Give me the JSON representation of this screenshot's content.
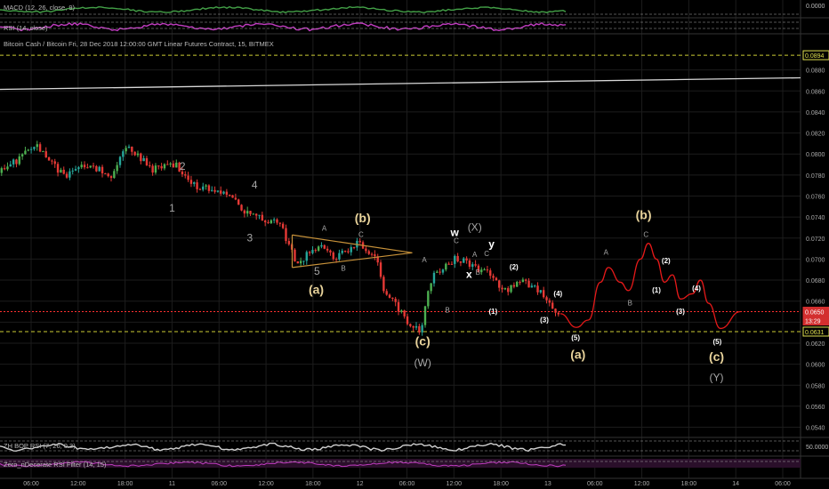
{
  "header": {
    "macd_label": "MACD (12, 26, close, 9)",
    "rsi_label": "RSI (14, close)",
    "symbol_label": "Bitcoin Cash / Bitcoin Fri, 28 Dec 2018 12:00:00 GMT Linear Futures Contract, 15, BITMEX",
    "bop_label": "ZH BOP RSI (7, 26, 0.3)",
    "zero_label": "Zero_nDecerate RSI Filter (14, 15)"
  },
  "macd_axis_value": "0.0000",
  "bottom_axis_value": "50.0000",
  "colors": {
    "background": "#000000",
    "grid": "#1c1c1c",
    "candle_up": "#26a69a",
    "candle_up_bright": "#4caf50",
    "candle_down": "#e53935",
    "forecast": "#e51919",
    "triangle": "#c8923a",
    "label_gold": "#e8d39b",
    "label_grey": "#a6a6a6",
    "price_line": "#ff3030",
    "marker_line": "#cccc33",
    "rsi_line": "#c03cc0",
    "bop_line": "#d0d0d0"
  },
  "chart_data": {
    "type": "candlestick",
    "title": "Bitcoin Cash / Bitcoin Fri, 28 Dec 2018 12:00:00 GMT Linear Futures Contract, 15, BITMEX",
    "y_ticks": [
      "0.0880",
      "0.0860",
      "0.0840",
      "0.0820",
      "0.0800",
      "0.0780",
      "0.0760",
      "0.0740",
      "0.0720",
      "0.0700",
      "0.0680",
      "0.0660",
      "0.0640",
      "0.0620",
      "0.0600",
      "0.0580",
      "0.0560",
      "0.0540"
    ],
    "ylim": [
      0.0532,
      0.09
    ],
    "x_ticks": [
      "06:00",
      "12:00",
      "18:00",
      "11",
      "06:00",
      "12:00",
      "18:00",
      "12",
      "06:00",
      "12:00",
      "18:00",
      "13",
      "06:00",
      "12:00",
      "18:00",
      "14",
      "06:00"
    ],
    "price_badges": [
      {
        "text": "0.0894",
        "style": "yellow"
      },
      {
        "text": "0.0650",
        "style": "red"
      },
      {
        "text": "13:29",
        "style": "red"
      },
      {
        "text": "0.0631",
        "style": "yellow"
      }
    ],
    "levels": [
      {
        "value": 0.0894,
        "kind": "dashed-yellow"
      },
      {
        "value": 0.065,
        "kind": "dotted-red"
      },
      {
        "value": 0.0631,
        "kind": "dashed-yellow"
      }
    ],
    "trendline": {
      "from": [
        0,
        0.08615
      ],
      "to": [
        1,
        0.08725
      ]
    },
    "price_path": [
      {
        "t": 0.0,
        "v": 0.0782
      },
      {
        "t": 0.04,
        "v": 0.0805
      },
      {
        "t": 0.045,
        "v": 0.081
      },
      {
        "t": 0.08,
        "v": 0.0778
      },
      {
        "t": 0.11,
        "v": 0.079
      },
      {
        "t": 0.14,
        "v": 0.078
      },
      {
        "t": 0.16,
        "v": 0.0808
      },
      {
        "t": 0.19,
        "v": 0.0785
      },
      {
        "t": 0.22,
        "v": 0.079
      },
      {
        "t": 0.24,
        "v": 0.077
      },
      {
        "t": 0.28,
        "v": 0.0765
      },
      {
        "t": 0.31,
        "v": 0.0742
      },
      {
        "t": 0.35,
        "v": 0.0735
      },
      {
        "t": 0.37,
        "v": 0.0695
      },
      {
        "t": 0.4,
        "v": 0.0715
      },
      {
        "t": 0.42,
        "v": 0.07
      },
      {
        "t": 0.445,
        "v": 0.0715
      },
      {
        "t": 0.47,
        "v": 0.0703
      },
      {
        "t": 0.48,
        "v": 0.067
      },
      {
        "t": 0.51,
        "v": 0.064
      },
      {
        "t": 0.525,
        "v": 0.0632
      },
      {
        "t": 0.54,
        "v": 0.0685
      },
      {
        "t": 0.57,
        "v": 0.0702
      },
      {
        "t": 0.59,
        "v": 0.0692
      },
      {
        "t": 0.61,
        "v": 0.0686
      },
      {
        "t": 0.63,
        "v": 0.067
      },
      {
        "t": 0.65,
        "v": 0.0678
      },
      {
        "t": 0.67,
        "v": 0.0673
      },
      {
        "t": 0.69,
        "v": 0.0653
      },
      {
        "t": 0.7,
        "v": 0.065
      }
    ],
    "forecast_path": [
      [
        0.7,
        0.0648
      ],
      [
        0.72,
        0.0635
      ],
      [
        0.735,
        0.0642
      ],
      [
        0.75,
        0.0678
      ],
      [
        0.76,
        0.0692
      ],
      [
        0.775,
        0.0678
      ],
      [
        0.785,
        0.067
      ],
      [
        0.8,
        0.07
      ],
      [
        0.81,
        0.0715
      ],
      [
        0.82,
        0.07
      ],
      [
        0.83,
        0.0678
      ],
      [
        0.84,
        0.0685
      ],
      [
        0.85,
        0.0662
      ],
      [
        0.865,
        0.0667
      ],
      [
        0.875,
        0.068
      ],
      [
        0.885,
        0.0658
      ],
      [
        0.9,
        0.0634
      ],
      [
        0.925,
        0.065
      ]
    ],
    "triangle": [
      [
        0.365,
        0.0723
      ],
      [
        0.515,
        0.0706
      ],
      [
        0.365,
        0.0692
      ],
      [
        0.48,
        0.0702
      ]
    ],
    "wave_labels": [
      {
        "text": "2",
        "t": 0.228,
        "v": 0.0785,
        "color": "grey",
        "size": "m"
      },
      {
        "text": "1",
        "t": 0.215,
        "v": 0.0745,
        "color": "grey",
        "size": "m"
      },
      {
        "text": "4",
        "t": 0.318,
        "v": 0.0767,
        "color": "grey",
        "size": "m"
      },
      {
        "text": "3",
        "t": 0.312,
        "v": 0.0717,
        "color": "grey",
        "size": "m"
      },
      {
        "text": "5",
        "t": 0.396,
        "v": 0.0685,
        "color": "grey",
        "size": "m"
      },
      {
        "text": "(a)",
        "t": 0.395,
        "v": 0.0667,
        "color": "gold",
        "size": "l"
      },
      {
        "text": "(b)",
        "t": 0.453,
        "v": 0.0735,
        "color": "gold",
        "size": "l"
      },
      {
        "text": "A",
        "t": 0.405,
        "v": 0.0727,
        "color": "grey",
        "size": "s"
      },
      {
        "text": "C",
        "t": 0.451,
        "v": 0.0721,
        "color": "grey",
        "size": "s"
      },
      {
        "text": "B",
        "t": 0.429,
        "v": 0.0689,
        "color": "grey",
        "size": "s"
      },
      {
        "text": "(c)",
        "t": 0.528,
        "v": 0.0618,
        "color": "gold",
        "size": "l"
      },
      {
        "text": "(W)",
        "t": 0.528,
        "v": 0.0598,
        "color": "grey",
        "size": "m"
      },
      {
        "text": "w",
        "t": 0.568,
        "v": 0.0722,
        "color": "white",
        "size": "m"
      },
      {
        "text": "(X)",
        "t": 0.593,
        "v": 0.0727,
        "color": "grey",
        "size": "m"
      },
      {
        "text": "y",
        "t": 0.614,
        "v": 0.0711,
        "color": "white",
        "size": "m"
      },
      {
        "text": "x",
        "t": 0.586,
        "v": 0.0682,
        "color": "white",
        "size": "m"
      },
      {
        "text": "A",
        "t": 0.53,
        "v": 0.0697,
        "color": "grey",
        "size": "s"
      },
      {
        "text": "B",
        "t": 0.559,
        "v": 0.0649,
        "color": "grey",
        "size": "s"
      },
      {
        "text": "C",
        "t": 0.57,
        "v": 0.0715,
        "color": "grey",
        "size": "s"
      },
      {
        "text": "A",
        "t": 0.593,
        "v": 0.0702,
        "color": "grey",
        "size": "s"
      },
      {
        "text": "B",
        "t": 0.597,
        "v": 0.0685,
        "color": "grey",
        "size": "s"
      },
      {
        "text": "C",
        "t": 0.608,
        "v": 0.0703,
        "color": "grey",
        "size": "s"
      },
      {
        "text": "(2)",
        "t": 0.642,
        "v": 0.069,
        "color": "white",
        "size": "s"
      },
      {
        "text": "(1)",
        "t": 0.616,
        "v": 0.0648,
        "color": "white",
        "size": "s"
      },
      {
        "text": "(4)",
        "t": 0.697,
        "v": 0.0665,
        "color": "white",
        "size": "s"
      },
      {
        "text": "(3)",
        "t": 0.68,
        "v": 0.064,
        "color": "white",
        "size": "s"
      },
      {
        "text": "(5)",
        "t": 0.719,
        "v": 0.0623,
        "color": "white",
        "size": "s"
      },
      {
        "text": "(a)",
        "t": 0.722,
        "v": 0.0605,
        "color": "gold",
        "size": "l"
      },
      {
        "text": "(b)",
        "t": 0.804,
        "v": 0.0738,
        "color": "gold",
        "size": "l"
      },
      {
        "text": "A",
        "t": 0.757,
        "v": 0.0704,
        "color": "grey",
        "size": "s"
      },
      {
        "text": "C",
        "t": 0.807,
        "v": 0.0721,
        "color": "grey",
        "size": "s"
      },
      {
        "text": "B",
        "t": 0.787,
        "v": 0.0656,
        "color": "grey",
        "size": "s"
      },
      {
        "text": "(2)",
        "t": 0.832,
        "v": 0.0696,
        "color": "white",
        "size": "s"
      },
      {
        "text": "(1)",
        "t": 0.82,
        "v": 0.0668,
        "color": "white",
        "size": "s"
      },
      {
        "text": "(4)",
        "t": 0.87,
        "v": 0.067,
        "color": "white",
        "size": "s"
      },
      {
        "text": "(3)",
        "t": 0.85,
        "v": 0.0648,
        "color": "white",
        "size": "s"
      },
      {
        "text": "(5)",
        "t": 0.896,
        "v": 0.0619,
        "color": "white",
        "size": "s"
      },
      {
        "text": "(c)",
        "t": 0.895,
        "v": 0.0603,
        "color": "gold",
        "size": "l"
      },
      {
        "text": "(Y)",
        "t": 0.895,
        "v": 0.0584,
        "color": "grey",
        "size": "m"
      }
    ]
  }
}
